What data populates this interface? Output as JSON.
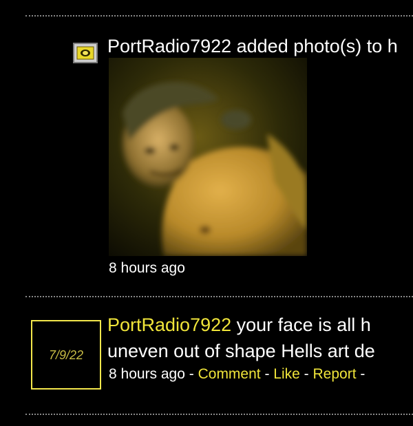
{
  "photo_activity": {
    "title": "PortRadio7922 added photo(s) to h",
    "timestamp": "8 hours ago"
  },
  "comment": {
    "avatar_date": "7/9/22",
    "username": "PortRadio7922",
    "text_line1": " your face is all h",
    "text_line2": "uneven out of shape Hells art de",
    "timestamp": "8 hours ago",
    "separator": " - ",
    "actions": {
      "comment": "Comment",
      "like": "Like",
      "report": "Report"
    },
    "trailing_separator": " -"
  },
  "colors": {
    "background": "#000000",
    "text": "#ffffff",
    "link_accent": "#f0e53a",
    "avatar_border": "#f4e84c",
    "divider": "#8a8a8a"
  },
  "icons": {
    "photo_entry": "photo-album-icon"
  }
}
